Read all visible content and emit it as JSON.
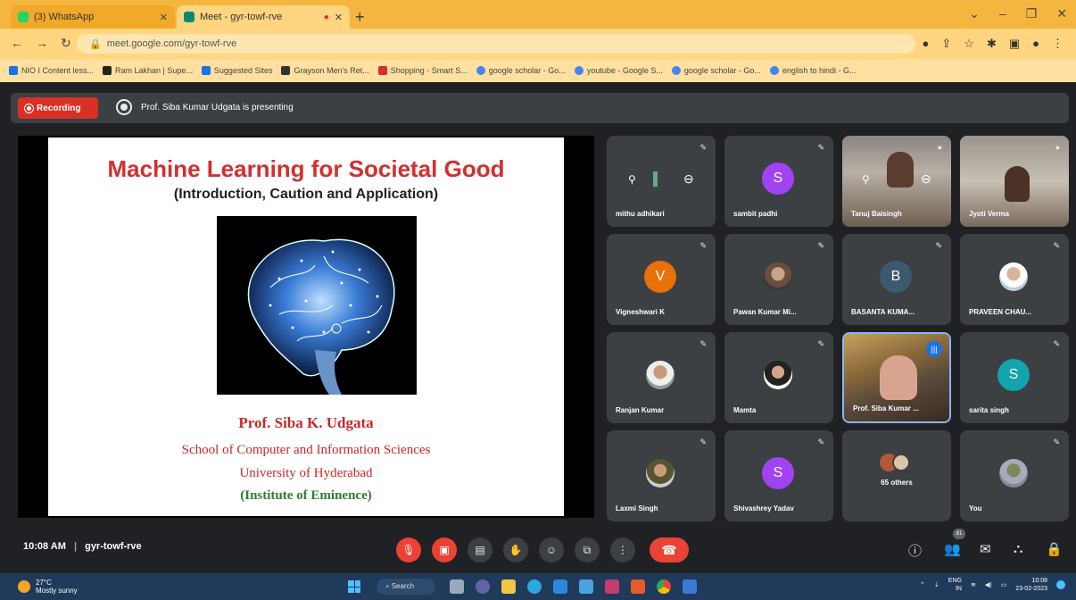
{
  "browser": {
    "tabs": [
      {
        "title": "(3) WhatsApp",
        "active": false,
        "color": "#25d366"
      },
      {
        "title": "Meet - gyr-towf-rve",
        "active": true,
        "color": "#00897b"
      }
    ],
    "url": "meet.google.com/gyr-towf-rve",
    "bookmarks": [
      "NIO I Content less...",
      "Ram Lakhan | Supe...",
      "Suggested Sites",
      "Grayson Men's Ret...",
      "Shopping - Smart S...",
      "google scholar - Go...",
      "youtube - Google S...",
      "google scholar - Go...",
      "english to hindi - G..."
    ]
  },
  "meet": {
    "recording_label": "Recording",
    "presenting_text": "Prof. Siba Kumar Udgata is presenting",
    "slide": {
      "title": "Machine Learning for Societal Good",
      "subtitle": "(Introduction, Caution and Application)",
      "author": "Prof. Siba K. Udgata",
      "school": "School of Computer and Information Sciences",
      "university": "University of Hyderabad",
      "institute": "(Institute of Eminence)"
    },
    "participants": [
      {
        "name": "mithu adhikari"
      },
      {
        "name": "sambit padhi",
        "initial": "S",
        "color": "#a142f4"
      },
      {
        "name": "Tanuj Baisingh"
      },
      {
        "name": "Jyoti Verma"
      },
      {
        "name": "Vigneshwari K",
        "initial": "V",
        "color": "#e8710a"
      },
      {
        "name": "Pawan Kumar Mi..."
      },
      {
        "name": "BASANTA KUMA...",
        "initial": "B",
        "color": "#3c5a6e"
      },
      {
        "name": "PRAVEEN CHAU..."
      },
      {
        "name": "Ranjan Kumar"
      },
      {
        "name": "Mamta"
      },
      {
        "name": "Prof. Siba Kumar ..."
      },
      {
        "name": "sarita singh",
        "initial": "S",
        "color": "#12a4af"
      },
      {
        "name": "Laxmi Singh"
      },
      {
        "name": "Shivashrey Yadav",
        "initial": "S",
        "color": "#a142f4"
      },
      {
        "name": "65 others"
      },
      {
        "name": "You"
      }
    ],
    "meeting_time": "10:08 AM",
    "meeting_code": "gyr-towf-rve",
    "participant_count": "81"
  },
  "taskbar": {
    "temperature": "27°C",
    "weather_desc": "Mostly sunny",
    "search_label": "Search",
    "lang": "ENG",
    "lang_sub": "IN",
    "clock_time": "10:08",
    "clock_date": "23-02-2023"
  }
}
